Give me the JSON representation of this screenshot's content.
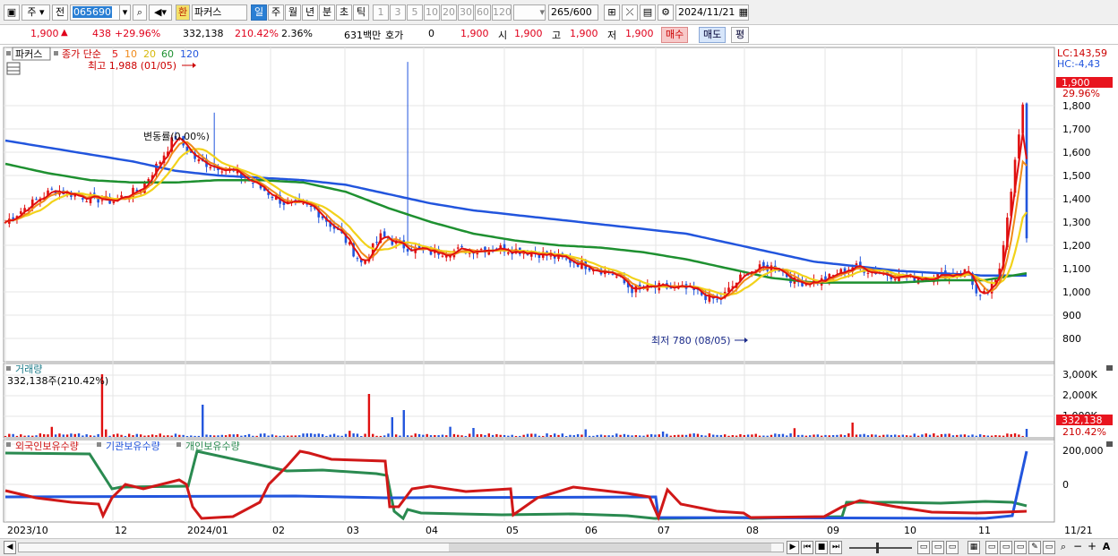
{
  "toolbar": {
    "mode": "주",
    "market": "전",
    "code": "065690",
    "flag": "환",
    "name": "파커스",
    "periods": [
      "일",
      "주",
      "월",
      "년",
      "분",
      "초",
      "틱"
    ],
    "numbers": [
      "1",
      "3",
      "5",
      "10",
      "20",
      "30",
      "60",
      "120"
    ],
    "count": "265",
    "count_total": "/600",
    "date": "2024/11/21"
  },
  "quote": {
    "price": "1,900",
    "change": "438",
    "change_pct": "+29.96%",
    "volume": "332,138",
    "vol_ratio": "210.42%",
    "turnover": "2.36%",
    "amount": "631백만",
    "hoga_label": "호가",
    "hoga_value": "0",
    "hoga_price": "1,900",
    "open_label": "시",
    "open": "1,900",
    "high_label": "고",
    "high": "1,900",
    "low_label": "저",
    "low": "1,900",
    "buy": "매수",
    "sell": "매도",
    "avg": "평"
  },
  "price_panel": {
    "legend_name": "파커스",
    "legend_ma_label": "종가 단순",
    "ma_periods": [
      "5",
      "10",
      "20",
      "60",
      "120"
    ],
    "ma_colors": [
      "#e01010",
      "#f08a1a",
      "#f2d21a",
      "#1e9030",
      "#2255dd"
    ],
    "high_annotation": "최고 1,988 (01/05)",
    "low_annotation": "최저 780 (08/05)",
    "mid_annotation": "변동률(0.00%)",
    "lc": "LC:143,59",
    "hc": "HC:-4,43",
    "price_tag": "1,900",
    "pct_tag": "29.96%",
    "y_ticks": [
      "1,800",
      "1,700",
      "1,600",
      "1,500",
      "1,400",
      "1,300",
      "1,200",
      "1,100",
      "1,000",
      "900",
      "800"
    ]
  },
  "volume_panel": {
    "title": "거래량",
    "value": "332,138주(210.42%)",
    "y_ticks": [
      "3,000K",
      "2,000K",
      "1,000K"
    ],
    "tag": "332,138",
    "tag2": "210.42%"
  },
  "holding_panel": {
    "series": [
      "외국인보유수량",
      "기관보유수량",
      "개인보유수량"
    ],
    "colors": [
      "#d01818",
      "#2255dd",
      "#2a8a50"
    ],
    "y_ticks": [
      "200,000",
      "0"
    ]
  },
  "x_axis": [
    "2023/10",
    "12",
    "2024/01",
    "02",
    "03",
    "04",
    "05",
    "06",
    "07",
    "08",
    "09",
    "10",
    "11"
  ],
  "x_axis_end": "11/21",
  "chart_data": {
    "type": "candlestick",
    "ylim": [
      780,
      1988
    ],
    "x_range": [
      "2023/10",
      "2024/11/21"
    ],
    "high": {
      "value": 1988,
      "date": "01/05"
    },
    "low": {
      "value": 780,
      "date": "08/05"
    },
    "last_close": 1900,
    "ma_approx": {
      "ma120": [
        1650,
        1620,
        1590,
        1560,
        1520,
        1500,
        1490,
        1480,
        1460,
        1420,
        1380,
        1350,
        1330,
        1310,
        1290,
        1270,
        1250,
        1210,
        1170,
        1130,
        1110,
        1090,
        1080,
        1070,
        1070
      ],
      "ma60": [
        1550,
        1510,
        1480,
        1470,
        1470,
        1480,
        1480,
        1470,
        1430,
        1360,
        1300,
        1250,
        1220,
        1200,
        1190,
        1170,
        1140,
        1100,
        1060,
        1040,
        1040,
        1040,
        1050,
        1050,
        1080
      ]
    }
  }
}
